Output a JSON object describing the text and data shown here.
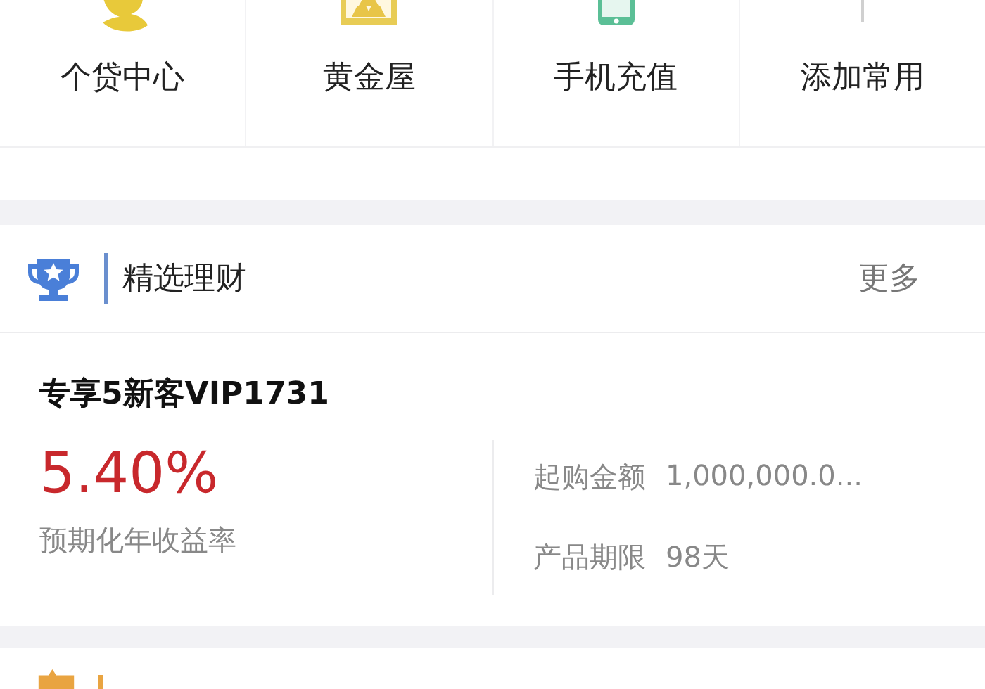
{
  "shortcuts": [
    {
      "label": "个贷中心",
      "kind": "loan"
    },
    {
      "label": "黄金屋",
      "kind": "gold"
    },
    {
      "label": "手机充值",
      "kind": "phone"
    },
    {
      "label": "添加常用",
      "kind": "add"
    }
  ],
  "section": {
    "title": "精选理财",
    "more": "更多"
  },
  "product": {
    "name": "专享5新客VIP1731",
    "rate": "5.40%",
    "rate_label": "预期化年收益率",
    "details": [
      {
        "label": "起购金额",
        "value": "1,000,000.0..."
      },
      {
        "label": "产品期限",
        "value": "98天"
      }
    ]
  }
}
